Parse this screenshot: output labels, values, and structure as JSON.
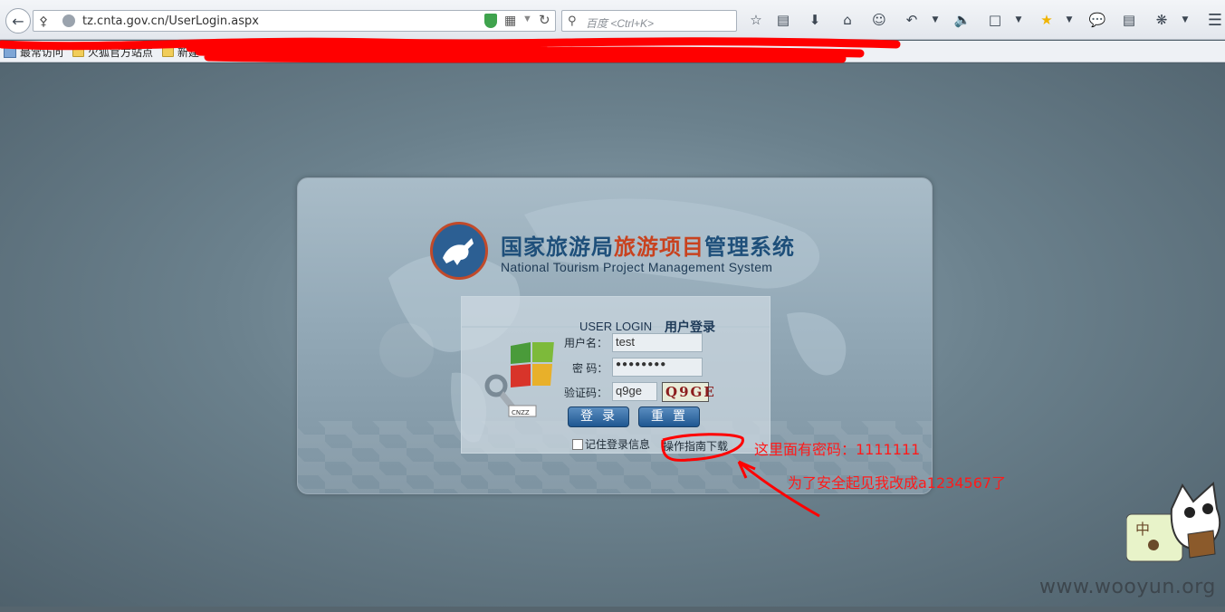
{
  "browser": {
    "url": "tz.cnta.gov.cn/UserLogin.aspx",
    "search_placeholder": "百度 <Ctrl+K>"
  },
  "bookmarks": [
    {
      "label": "最常访问"
    },
    {
      "label": "火狐官方站点"
    },
    {
      "label": "新建"
    }
  ],
  "header": {
    "title_zh_part1": "国家旅游局",
    "title_zh_part2": "旅游项目",
    "title_zh_part3": "管理系统",
    "title_en": "National Tourism Project Management System",
    "accent_color": "#c8421f",
    "brand_color": "#1e4f7a"
  },
  "login": {
    "heading_en": "USER LOGIN",
    "heading_zh": "用户登录",
    "username_label": "用户名：",
    "username_value": "test",
    "password_label": "密 码：",
    "password_value": "●●●●●●●●",
    "captcha_label": "验证码：",
    "captcha_value": "q9ge",
    "captcha_image_text": "Q9GE",
    "login_button": "登录",
    "reset_button": "重置",
    "remember_label": "记住登录信息",
    "guide_link": "操作指南下载"
  },
  "annotations": {
    "note1": "这里面有密码：1111111",
    "note2": "为了安全起见我改成a1234567了",
    "color": "#ff1a1a"
  },
  "watermark": "www.wooyun.org"
}
